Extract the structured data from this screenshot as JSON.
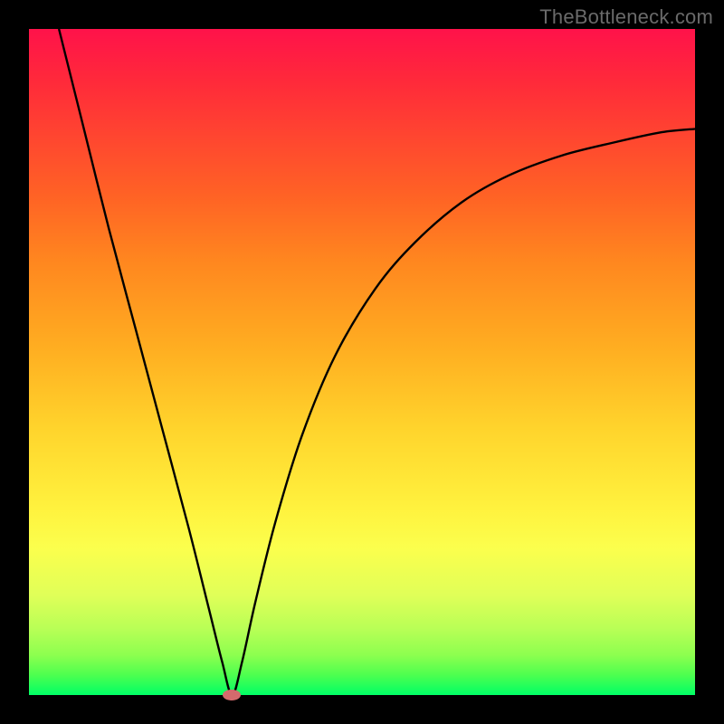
{
  "source_label": "TheBottleneck.com",
  "chart_data": {
    "type": "line",
    "title": "",
    "xlabel": "",
    "ylabel": "",
    "xlim": [
      0,
      100
    ],
    "ylim": [
      0,
      100
    ],
    "minimum": {
      "x": 30.5,
      "y": 0
    },
    "series": [
      {
        "name": "curve",
        "points": [
          {
            "x": 4.5,
            "y": 100
          },
          {
            "x": 8,
            "y": 86
          },
          {
            "x": 12,
            "y": 70
          },
          {
            "x": 16,
            "y": 55
          },
          {
            "x": 20,
            "y": 40
          },
          {
            "x": 24,
            "y": 25
          },
          {
            "x": 27,
            "y": 13
          },
          {
            "x": 29,
            "y": 5
          },
          {
            "x": 30.5,
            "y": 0
          },
          {
            "x": 32,
            "y": 5
          },
          {
            "x": 34,
            "y": 14
          },
          {
            "x": 37,
            "y": 26
          },
          {
            "x": 41,
            "y": 39
          },
          {
            "x": 46,
            "y": 51
          },
          {
            "x": 52,
            "y": 61
          },
          {
            "x": 58,
            "y": 68
          },
          {
            "x": 65,
            "y": 74
          },
          {
            "x": 72,
            "y": 78
          },
          {
            "x": 80,
            "y": 81
          },
          {
            "x": 88,
            "y": 83
          },
          {
            "x": 95,
            "y": 84.5
          },
          {
            "x": 100,
            "y": 85
          }
        ]
      }
    ]
  },
  "marker_color": "#d46a6d"
}
